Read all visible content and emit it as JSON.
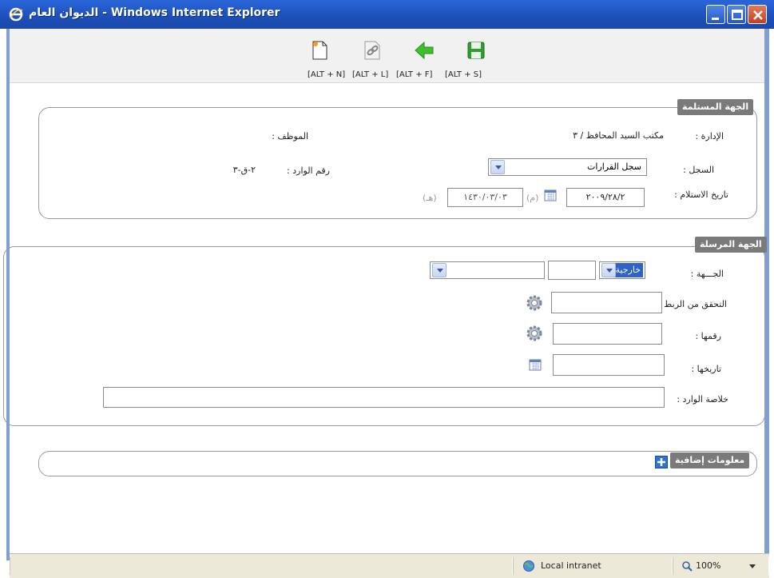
{
  "window": {
    "title": "الديوان العام - Windows Internet Explorer",
    "colors": {
      "titlebar": "#1d4fb8",
      "legend_bg": "#7a7a7a",
      "select_highlight": "#2f62c8"
    }
  },
  "toolbar": {
    "items": [
      {
        "icon": "new-document-icon",
        "shortcut": "[ALT + N]"
      },
      {
        "icon": "link-icon",
        "shortcut": "[ALT + L]"
      },
      {
        "icon": "forward-arrow-icon",
        "shortcut": "[ALT + F]"
      },
      {
        "icon": "save-icon",
        "shortcut": "[ALT + S]"
      }
    ]
  },
  "receiving": {
    "legend": "الجهة المستلمة",
    "department_label": "الإدارة :",
    "department_value": "مكتب السيد المحافظ / ٣",
    "employee_label": "الموظف :",
    "register_label": "السجل :",
    "register_value": "سجل القرارات",
    "incoming_no_label": "رقم الوارد :",
    "incoming_no_value": "٢-ق-٣",
    "receipt_date_label": "تاريخ الاستلام :",
    "gregorian_date": "٢٠٠٩/٢٨/٢",
    "gregorian_suffix": "(م)",
    "hijri_date": "١٤٣٠/٠٣/٠٣",
    "hijri_suffix": "(هـ)"
  },
  "sender": {
    "legend": "الجهة المرسلة",
    "entity_label": "الجـــهة :",
    "entity_type_value": "خارجية",
    "link_check_label": "التحقق من الربط :",
    "number_label": "رقمها :",
    "date_label": "تاريخها :",
    "summary_label": "خلاصة الوارد :"
  },
  "extra": {
    "legend": "معلومات إضافية"
  },
  "statusbar": {
    "zone": "Local intranet",
    "zoom": "100%"
  }
}
